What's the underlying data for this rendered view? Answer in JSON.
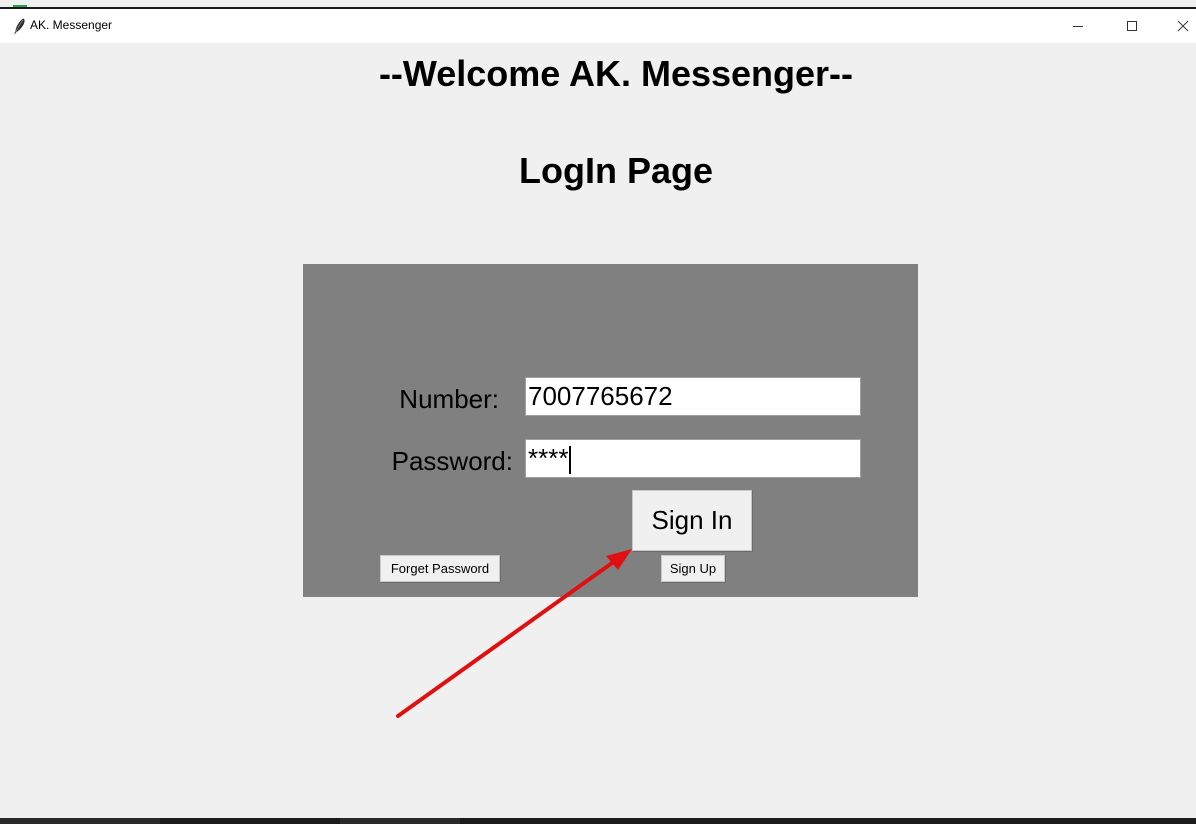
{
  "window": {
    "title": "AK. Messenger",
    "icon": "feather-icon"
  },
  "page": {
    "welcome": "--Welcome AK. Messenger--",
    "title": "LogIn Page"
  },
  "form": {
    "number_label": "Number:",
    "number_value": "7007765672",
    "password_label": "Password:",
    "password_value": "****",
    "signin_label": "Sign In",
    "forget_label": "Forget Password",
    "signup_label": "Sign Up"
  },
  "colors": {
    "background": "#f0f0f0",
    "panel": "#808080",
    "arrow": "#e01010"
  }
}
